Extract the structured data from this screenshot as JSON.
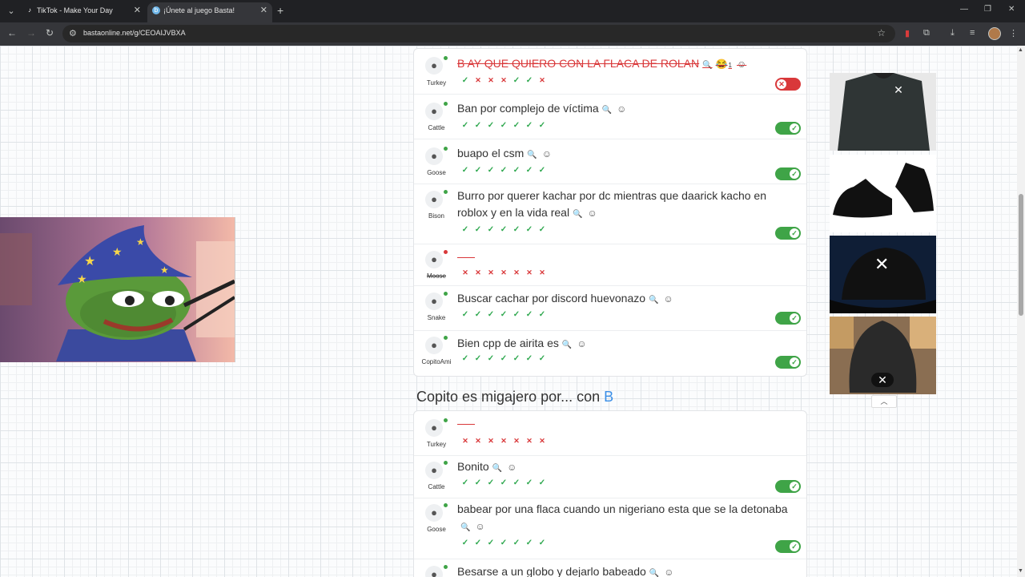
{
  "browser": {
    "tabs": [
      {
        "title": "TikTok - Make Your Day",
        "active": false
      },
      {
        "title": "¡Únete al juego Basta!",
        "active": true
      }
    ],
    "url": "bastaonline.net/g/CEOAIJVBXA"
  },
  "colors": {
    "accent": "#3a8ee6",
    "ok": "#3fa447",
    "bad": "#d9383a"
  },
  "round1": {
    "rows": [
      {
        "player": "Turkey",
        "status": "online",
        "answer": "B AY QUE QUIERO CON LA FLACA DE ROLAN",
        "struck": true,
        "emoji": "😂",
        "emoji_count": "1",
        "votes": [
          "ok",
          "no",
          "no",
          "no",
          "ok",
          "ok",
          "no"
        ],
        "toggle": "off"
      },
      {
        "player": "Cattle",
        "status": "online",
        "answer": "Ban por complejo de víctima",
        "votes": [
          "ok",
          "ok",
          "ok",
          "ok",
          "ok",
          "ok",
          "ok"
        ],
        "toggle": "on"
      },
      {
        "player": "Goose",
        "status": "online",
        "answer": "buapo el csm",
        "votes": [
          "ok",
          "ok",
          "ok",
          "ok",
          "ok",
          "ok",
          "ok"
        ],
        "toggle": "on"
      },
      {
        "player": "Bison",
        "status": "online",
        "answer": "Burro por querer kachar por dc mientras que daarick kacho en roblox y en la vida real",
        "votes": [
          "ok",
          "ok",
          "ok",
          "ok",
          "ok",
          "ok",
          "ok"
        ],
        "toggle": "on"
      },
      {
        "player": "Moose",
        "status": "offline",
        "answer": "",
        "votes": [
          "no",
          "no",
          "no",
          "no",
          "no",
          "no",
          "no"
        ]
      },
      {
        "player": "Snake",
        "status": "online",
        "answer": "Buscar cachar por discord huevonazo",
        "votes": [
          "ok",
          "ok",
          "ok",
          "ok",
          "ok",
          "ok",
          "ok"
        ],
        "toggle": "on"
      },
      {
        "player": "CopitoAmi",
        "status": "online",
        "answer": "Bien cpp de airita es",
        "votes": [
          "ok",
          "ok",
          "ok",
          "ok",
          "ok",
          "ok",
          "ok"
        ],
        "toggle": "on"
      }
    ]
  },
  "round2": {
    "title": "Copito es migajero por... con",
    "letter": "B",
    "rows": [
      {
        "player": "Turkey",
        "answer": "",
        "votes": [
          "no",
          "no",
          "no",
          "no",
          "no",
          "no",
          "no"
        ]
      },
      {
        "player": "Cattle",
        "answer": "Bonito",
        "votes": [
          "ok",
          "ok",
          "ok",
          "ok",
          "ok",
          "ok",
          "ok"
        ],
        "toggle": "on"
      },
      {
        "player": "Goose",
        "answer": "babear por una flaca cuando un nigeriano esta que se la detonaba",
        "votes": [
          "ok",
          "ok",
          "ok",
          "ok",
          "ok",
          "ok",
          "ok"
        ],
        "toggle": "on"
      },
      {
        "player": "",
        "answer": "Besarse a un globo y dejarlo babeado"
      }
    ]
  }
}
